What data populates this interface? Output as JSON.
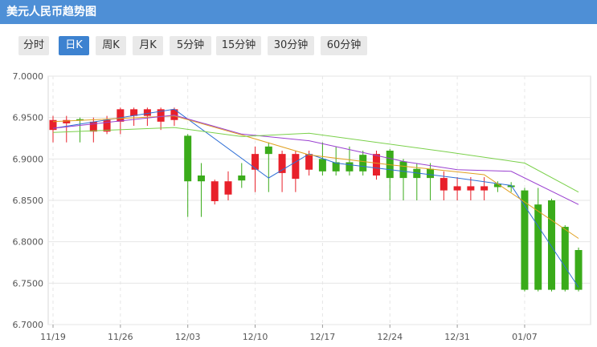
{
  "window": {
    "title": "美元人民币趋势图"
  },
  "tabs": [
    {
      "label": "分时",
      "active": false
    },
    {
      "label": "日K",
      "active": true
    },
    {
      "label": "周K",
      "active": false
    },
    {
      "label": "月K",
      "active": false
    },
    {
      "label": "5分钟",
      "active": false
    },
    {
      "label": "15分钟",
      "active": false
    },
    {
      "label": "30分钟",
      "active": false
    },
    {
      "label": "60分钟",
      "active": false
    }
  ],
  "colors": {
    "title_bg": "#4e8fd6",
    "tab_active": "#3d82d0",
    "up": "#e8202a",
    "down": "#3aab1a",
    "ma5": "#2f6fd6",
    "ma10": "#e0a020",
    "ma20": "#9a40d0",
    "ma30": "#7ad04a",
    "grid": "#e6e6e6"
  },
  "chart_data": {
    "type": "candlestick",
    "ylim": [
      6.7,
      7.0
    ],
    "yticks": [
      "6.7000",
      "6.7500",
      "6.8000",
      "6.8500",
      "6.9000",
      "6.9500",
      "7.0000"
    ],
    "xticks": [
      {
        "label": "11/19",
        "index": 0
      },
      {
        "label": "11/26",
        "index": 5
      },
      {
        "label": "12/03",
        "index": 10
      },
      {
        "label": "12/10",
        "index": 15
      },
      {
        "label": "12/17",
        "index": 20
      },
      {
        "label": "12/24",
        "index": 25
      },
      {
        "label": "12/31",
        "index": 30
      },
      {
        "label": "01/07",
        "index": 35
      }
    ],
    "candles": [
      {
        "open": 6.935,
        "close": 6.947,
        "high": 6.952,
        "low": 6.92
      },
      {
        "open": 6.943,
        "close": 6.947,
        "high": 6.952,
        "low": 6.92
      },
      {
        "open": 6.948,
        "close": 6.947,
        "high": 6.95,
        "low": 6.92
      },
      {
        "open": 6.933,
        "close": 6.945,
        "high": 6.95,
        "low": 6.92
      },
      {
        "open": 6.933,
        "close": 6.947,
        "high": 6.952,
        "low": 6.93
      },
      {
        "open": 6.945,
        "close": 6.96,
        "high": 6.962,
        "low": 6.93
      },
      {
        "open": 6.952,
        "close": 6.96,
        "high": 6.962,
        "low": 6.94
      },
      {
        "open": 6.952,
        "close": 6.96,
        "high": 6.962,
        "low": 6.94
      },
      {
        "open": 6.945,
        "close": 6.96,
        "high": 6.962,
        "low": 6.935
      },
      {
        "open": 6.947,
        "close": 6.96,
        "high": 6.962,
        "low": 6.94
      },
      {
        "open": 6.928,
        "close": 6.873,
        "high": 6.93,
        "low": 6.83
      },
      {
        "open": 6.88,
        "close": 6.873,
        "high": 6.895,
        "low": 6.83
      },
      {
        "open": 6.849,
        "close": 6.873,
        "high": 6.875,
        "low": 6.845
      },
      {
        "open": 6.857,
        "close": 6.873,
        "high": 6.885,
        "low": 6.85
      },
      {
        "open": 6.88,
        "close": 6.874,
        "high": 6.895,
        "low": 6.865
      },
      {
        "open": 6.887,
        "close": 6.906,
        "high": 6.915,
        "low": 6.86
      },
      {
        "open": 6.915,
        "close": 6.906,
        "high": 6.92,
        "low": 6.86
      },
      {
        "open": 6.883,
        "close": 6.906,
        "high": 6.91,
        "low": 6.86
      },
      {
        "open": 6.876,
        "close": 6.906,
        "high": 6.91,
        "low": 6.86
      },
      {
        "open": 6.887,
        "close": 6.906,
        "high": 6.91,
        "low": 6.88
      },
      {
        "open": 6.9,
        "close": 6.885,
        "high": 6.92,
        "low": 6.88
      },
      {
        "open": 6.896,
        "close": 6.885,
        "high": 6.915,
        "low": 6.88
      },
      {
        "open": 6.896,
        "close": 6.885,
        "high": 6.915,
        "low": 6.88
      },
      {
        "open": 6.905,
        "close": 6.885,
        "high": 6.91,
        "low": 6.88
      },
      {
        "open": 6.88,
        "close": 6.906,
        "high": 6.91,
        "low": 6.875
      },
      {
        "open": 6.91,
        "close": 6.877,
        "high": 6.912,
        "low": 6.85
      },
      {
        "open": 6.897,
        "close": 6.877,
        "high": 6.9,
        "low": 6.85
      },
      {
        "open": 6.888,
        "close": 6.877,
        "high": 6.895,
        "low": 6.85
      },
      {
        "open": 6.888,
        "close": 6.877,
        "high": 6.895,
        "low": 6.85
      },
      {
        "open": 6.862,
        "close": 6.877,
        "high": 6.885,
        "low": 6.85
      },
      {
        "open": 6.862,
        "close": 6.867,
        "high": 6.878,
        "low": 6.85
      },
      {
        "open": 6.862,
        "close": 6.867,
        "high": 6.878,
        "low": 6.85
      },
      {
        "open": 6.862,
        "close": 6.867,
        "high": 6.878,
        "low": 6.85
      },
      {
        "open": 6.87,
        "close": 6.866,
        "high": 6.873,
        "low": 6.86
      },
      {
        "open": 6.868,
        "close": 6.866,
        "high": 6.872,
        "low": 6.86
      },
      {
        "open": 6.862,
        "close": 6.742,
        "high": 6.865,
        "low": 6.74
      },
      {
        "open": 6.845,
        "close": 6.742,
        "high": 6.865,
        "low": 6.74
      },
      {
        "open": 6.85,
        "close": 6.742,
        "high": 6.852,
        "low": 6.74
      },
      {
        "open": 6.818,
        "close": 6.742,
        "high": 6.82,
        "low": 6.74
      },
      {
        "open": 6.79,
        "close": 6.742,
        "high": 6.793,
        "low": 6.74
      }
    ],
    "ma5": [
      [
        0,
        6.937
      ],
      [
        9,
        6.96
      ],
      [
        16,
        6.877
      ],
      [
        19,
        6.906
      ],
      [
        21,
        6.895
      ],
      [
        26,
        6.885
      ],
      [
        30,
        6.877
      ],
      [
        34,
        6.868
      ],
      [
        39,
        6.745
      ]
    ],
    "ma10": [
      [
        0,
        6.945
      ],
      [
        9,
        6.952
      ],
      [
        14,
        6.929
      ],
      [
        19,
        6.905
      ],
      [
        25,
        6.893
      ],
      [
        32,
        6.881
      ],
      [
        39,
        6.804
      ]
    ],
    "ma20": [
      [
        0,
        6.937
      ],
      [
        9,
        6.953
      ],
      [
        14,
        6.93
      ],
      [
        19,
        6.922
      ],
      [
        26,
        6.897
      ],
      [
        30,
        6.887
      ],
      [
        34,
        6.885
      ],
      [
        39,
        6.845
      ]
    ],
    "ma30": [
      [
        0,
        6.932
      ],
      [
        9,
        6.938
      ],
      [
        14,
        6.927
      ],
      [
        19,
        6.931
      ],
      [
        29,
        6.909
      ],
      [
        35,
        6.895
      ],
      [
        39,
        6.86
      ]
    ]
  }
}
